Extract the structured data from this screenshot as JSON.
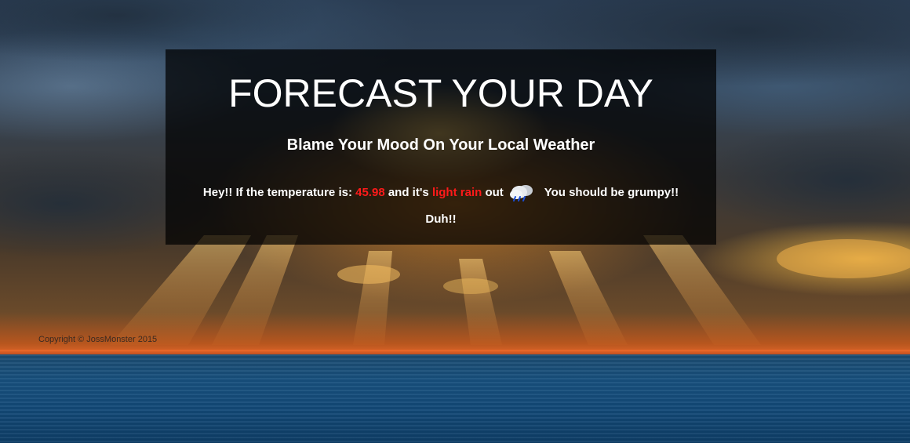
{
  "header": {
    "title": "FORECAST YOUR DAY",
    "subtitle": "Blame Your Mood On Your Local Weather"
  },
  "mood": {
    "prefix": "Hey!! If the temperature is:",
    "temperature": "45.98",
    "middle": "and it's",
    "condition": "light rain",
    "suffix": "out",
    "icon": "rain-cloud-icon",
    "verdict": "You should be grumpy!!",
    "closer": "Duh!!"
  },
  "footer": {
    "copyright": "Copyright © JossMonster 2015"
  },
  "colors": {
    "highlight": "#ff1a1a",
    "panel_bg": "rgba(0,0,0,0.72)",
    "text": "#ffffff"
  }
}
